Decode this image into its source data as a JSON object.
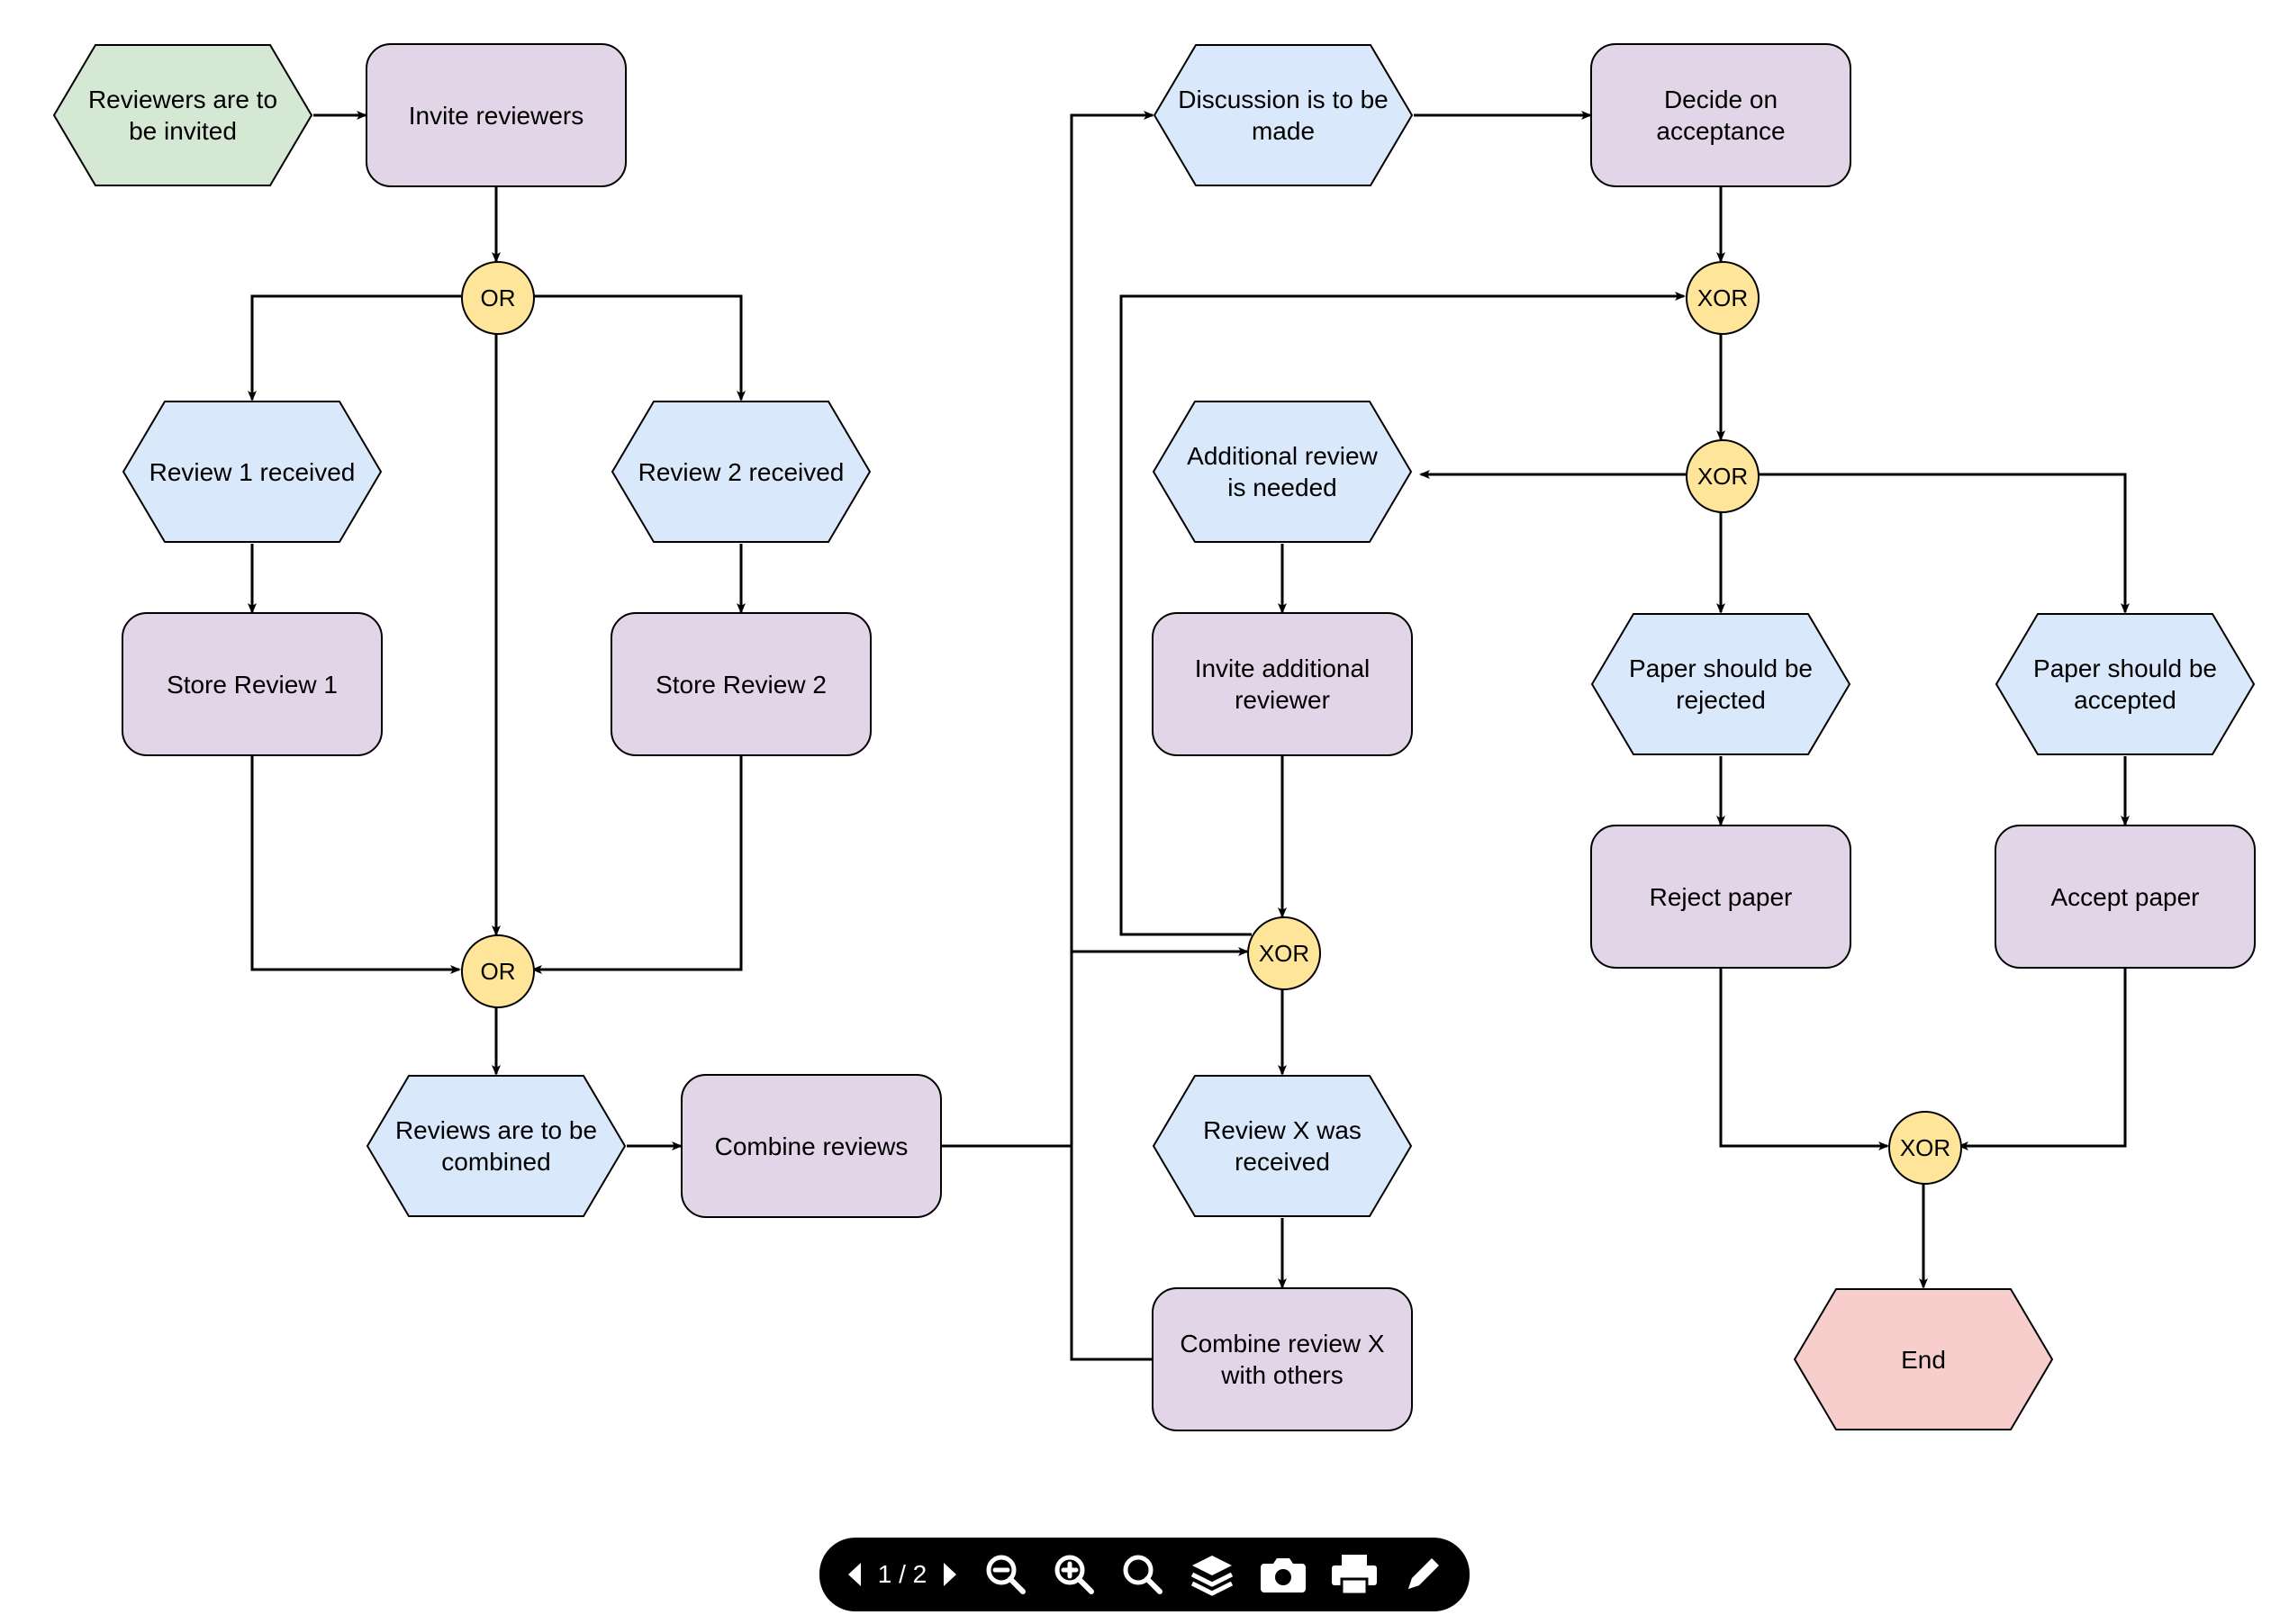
{
  "nodes": {
    "start": {
      "label": "Reviewers are to be invited"
    },
    "invite": {
      "label": "Invite reviewers"
    },
    "or1": {
      "label": "OR"
    },
    "rev1recv": {
      "label": "Review 1 received"
    },
    "rev2recv": {
      "label": "Review 2 received"
    },
    "store1": {
      "label": "Store Review 1"
    },
    "store2": {
      "label": "Store Review 2"
    },
    "or2": {
      "label": "OR"
    },
    "revsToCombine": {
      "label": "Reviews are to be combined"
    },
    "combine": {
      "label": "Combine reviews"
    },
    "discussion": {
      "label": "Discussion is to be made"
    },
    "decide": {
      "label": "Decide on acceptance"
    },
    "xor1": {
      "label": "XOR"
    },
    "xor2": {
      "label": "XOR"
    },
    "addNeeded": {
      "label": "Additional review is needed"
    },
    "inviteAdd": {
      "label": "Invite additional reviewer"
    },
    "xor3": {
      "label": "XOR"
    },
    "revXrecv": {
      "label": "Review X was received"
    },
    "combineX": {
      "label": "Combine review X with others"
    },
    "shouldReject": {
      "label": "Paper should be rejected"
    },
    "shouldAccept": {
      "label": "Paper should be accepted"
    },
    "reject": {
      "label": "Reject paper"
    },
    "accept": {
      "label": "Accept paper"
    },
    "xor4": {
      "label": "XOR"
    },
    "end": {
      "label": "End"
    }
  },
  "colors": {
    "eventBlue": "#dae8fc",
    "eventGreen": "#d5e8d4",
    "eventRed": "#f8cecc",
    "func": "#e1d5e7",
    "gate": "#ffe599"
  },
  "toolbar": {
    "page_current": "1",
    "page_total": "2",
    "page_display": "1 / 2"
  }
}
